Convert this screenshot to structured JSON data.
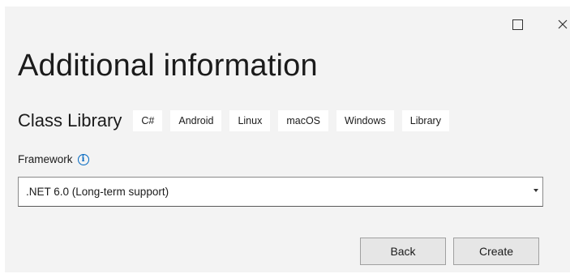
{
  "window": {
    "maximize_icon": "maximize-icon",
    "close_icon": "close-icon",
    "close_glyph": "✕"
  },
  "header": {
    "title": "Additional information"
  },
  "project": {
    "name": "Class Library",
    "tags": [
      "C#",
      "Android",
      "Linux",
      "macOS",
      "Windows",
      "Library"
    ]
  },
  "framework": {
    "label": "Framework",
    "info_glyph": "i",
    "selected_value": ".NET 6.0 (Long-term support)"
  },
  "footer": {
    "back_label": "Back",
    "create_label": "Create"
  },
  "colors": {
    "dialog_bg": "#f3f3f3",
    "accent": "#0067c0",
    "button_bg": "#e6e6e6"
  }
}
